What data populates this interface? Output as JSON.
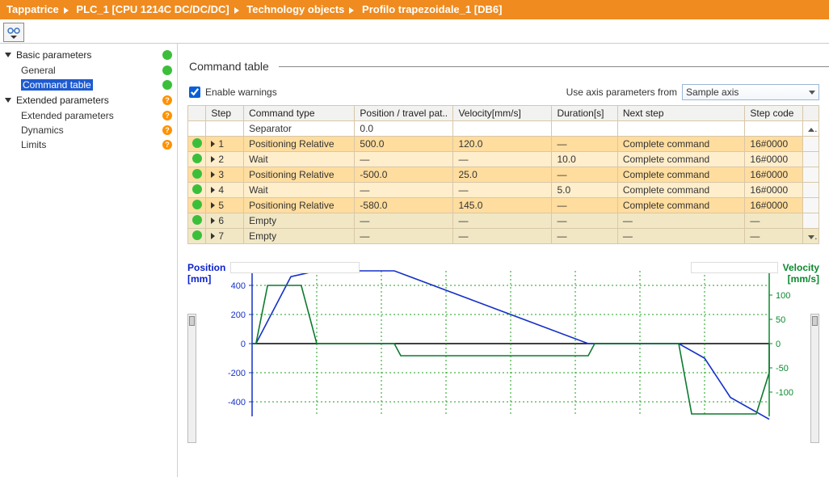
{
  "breadcrumb": [
    "Tappatrice",
    "PLC_1 [CPU 1214C DC/DC/DC]",
    "Technology objects",
    "Profilo trapezoidale_1 [DB6]"
  ],
  "nav": {
    "groups": [
      {
        "label": "Basic parameters",
        "status": "green",
        "items": [
          {
            "label": "General",
            "status": "green",
            "selected": false
          },
          {
            "label": "Command table",
            "status": "green",
            "selected": true
          }
        ]
      },
      {
        "label": "Extended parameters",
        "status": "qmark",
        "items": [
          {
            "label": "Extended parameters",
            "status": "qmark",
            "selected": false
          },
          {
            "label": "Dynamics",
            "status": "qmark",
            "selected": false
          },
          {
            "label": "Limits",
            "status": "qmark",
            "selected": false
          }
        ]
      }
    ]
  },
  "section_title": "Command table",
  "enable_warnings_label": "Enable warnings",
  "enable_warnings_checked": true,
  "axis_label": "Use axis parameters from",
  "axis_value": "Sample axis",
  "table": {
    "columns": [
      "",
      "Step",
      "Command type",
      "Position / travel pat..",
      "Velocity[mm/s]",
      "Duration[s]",
      "Next step",
      "Step code",
      ""
    ],
    "separator_row": {
      "type": "Separator",
      "pos": "0.0"
    },
    "rows": [
      {
        "status": "green",
        "step": "1",
        "type": "Positioning Relative",
        "pos": "500.0",
        "vel": "120.0",
        "dur": "—",
        "next": "Complete command",
        "code": "16#0000",
        "cls": "row-odd"
      },
      {
        "status": "green",
        "step": "2",
        "type": "Wait",
        "pos": "—",
        "vel": "—",
        "dur": "10.0",
        "next": "Complete command",
        "code": "16#0000",
        "cls": "row-even"
      },
      {
        "status": "green",
        "step": "3",
        "type": "Positioning Relative",
        "pos": "-500.0",
        "vel": "25.0",
        "dur": "—",
        "next": "Complete command",
        "code": "16#0000",
        "cls": "row-odd"
      },
      {
        "status": "green",
        "step": "4",
        "type": "Wait",
        "pos": "—",
        "vel": "—",
        "dur": "5.0",
        "next": "Complete command",
        "code": "16#0000",
        "cls": "row-even"
      },
      {
        "status": "green",
        "step": "5",
        "type": "Positioning Relative",
        "pos": "-580.0",
        "vel": "145.0",
        "dur": "—",
        "next": "Complete command",
        "code": "16#0000",
        "cls": "row-odd"
      },
      {
        "status": "green",
        "step": "6",
        "type": "Empty",
        "pos": "—",
        "vel": "—",
        "dur": "—",
        "next": "—",
        "code": "—",
        "cls": "row-empty"
      },
      {
        "status": "green",
        "step": "7",
        "type": "Empty",
        "pos": "—",
        "vel": "—",
        "dur": "—",
        "next": "—",
        "code": "—",
        "cls": "row-empty"
      }
    ]
  },
  "chart_data": {
    "type": "line",
    "pos_label": "Position",
    "pos_unit": "[mm]",
    "vel_label": "Velocity",
    "vel_unit": "[mm/s]",
    "pos_axis": {
      "ticks": [
        400,
        200,
        0,
        -200,
        -400
      ],
      "range": [
        -500,
        500
      ]
    },
    "vel_axis": {
      "ticks": [
        100,
        50,
        0,
        -50,
        -100
      ],
      "range": [
        -150,
        150
      ]
    },
    "x_range": [
      0,
      40
    ],
    "series": [
      {
        "name": "Position",
        "color": "#1530c8",
        "y_axis": "pos",
        "points": [
          [
            0,
            0
          ],
          [
            0.3,
            0
          ],
          [
            3,
            460
          ],
          [
            5,
            500
          ],
          [
            11,
            500
          ],
          [
            26,
            0
          ],
          [
            28,
            0
          ],
          [
            33,
            0
          ],
          [
            35,
            -100
          ],
          [
            37,
            -370
          ],
          [
            40,
            -520
          ]
        ]
      },
      {
        "name": "Velocity",
        "color": "#0c7a2f",
        "y_axis": "vel",
        "points": [
          [
            0,
            0
          ],
          [
            0.3,
            0
          ],
          [
            1.2,
            120
          ],
          [
            3.8,
            120
          ],
          [
            5,
            0
          ],
          [
            11,
            0
          ],
          [
            11.5,
            -25
          ],
          [
            26,
            -25
          ],
          [
            26.5,
            0
          ],
          [
            33,
            0
          ],
          [
            34,
            -145
          ],
          [
            39,
            -145
          ],
          [
            40,
            -60
          ],
          [
            40,
            0
          ]
        ]
      }
    ]
  }
}
